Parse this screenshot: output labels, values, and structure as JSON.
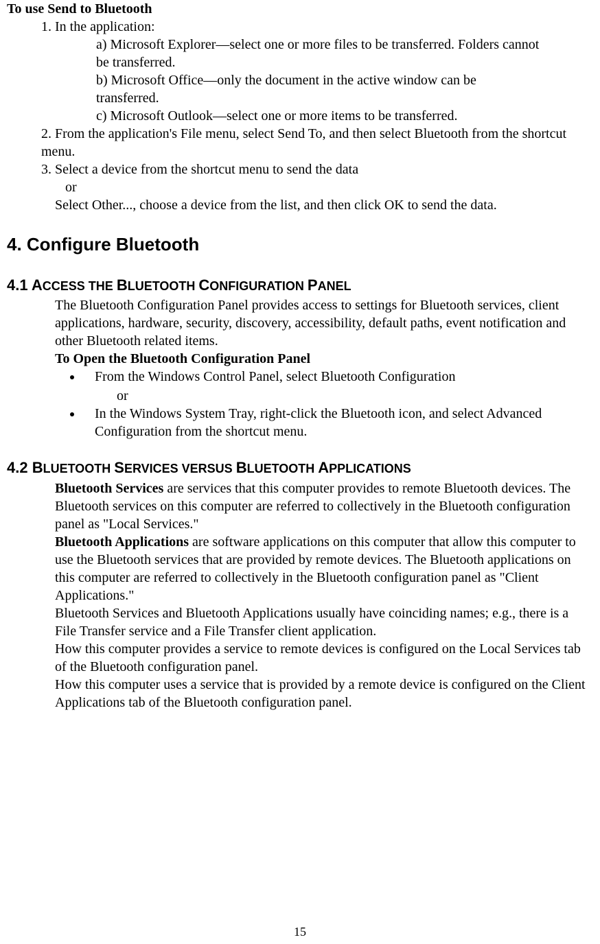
{
  "section_a": {
    "title": "To use Send to Bluetooth",
    "step1_intro": "1. In the application:",
    "step1_a": "a) Microsoft Explorer—select one or more files to be transferred. Folders cannot be transferred.",
    "step1_b": "b) Microsoft Office—only the document in the active window can be transferred.",
    "step1_c": "c) Microsoft Outlook—select one or more items to be transferred.",
    "step2": "2. From the application's File menu, select Send To, and then select Bluetooth from the shortcut menu.",
    "step3_a": "3. Select a device from the shortcut menu to send the data",
    "step3_or": "or",
    "step3_b": "Select Other..., choose a device from the list, and then click OK to send the data."
  },
  "heading_configure": "4. Configure Bluetooth",
  "section_41": {
    "heading_num": "4.1 ",
    "heading_A": "A",
    "heading_ccess": "CCESS THE ",
    "heading_B": "B",
    "heading_luetooth": "LUETOOTH ",
    "heading_C": "C",
    "heading_config": "ONFIGURATION ",
    "heading_P": "P",
    "heading_anel": "ANEL",
    "para": "The Bluetooth Configuration Panel provides access to settings for Bluetooth services, client applications, hardware, security, discovery, accessibility, default paths, event notification and other Bluetooth related items.",
    "toopen": "To Open the Bluetooth Configuration Panel",
    "bullet1": "From the Windows Control Panel, select Bluetooth Configuration",
    "bullet_or": "or",
    "bullet2": "In the Windows System Tray, right-click the Bluetooth icon, and select Advanced Configuration from the shortcut menu."
  },
  "section_42": {
    "heading_num": "4.2 ",
    "heading_B1": "B",
    "heading_luetooth1": "LUETOOTH ",
    "heading_S": "S",
    "heading_erv": "ERVICES VERSUS ",
    "heading_B2": "B",
    "heading_luetooth2": "LUETOOTH ",
    "heading_A": "A",
    "heading_pp": "PPLICATIONS",
    "bt_services_label": "Bluetooth Services",
    "bt_services_text": " are services that this computer provides to remote Bluetooth devices. The Bluetooth services on this computer are referred to collectively in the Bluetooth configuration panel as \"Local Services.\"",
    "bt_apps_label": "Bluetooth Applications",
    "bt_apps_text": " are software applications on this computer that allow this computer to use the Bluetooth services that are provided by remote devices. The Bluetooth applications on this computer are referred to collectively in the Bluetooth configuration panel as \"Client Applications.\"",
    "para3": "Bluetooth Services and Bluetooth Applications usually have coinciding names; e.g., there is a File Transfer service and a File Transfer client application.",
    "para4": "How this computer provides a service to remote devices is configured on the Local Services tab of the Bluetooth configuration panel.",
    "para5": "How this computer uses a service that is provided by a remote device is configured on the Client Applications tab of the Bluetooth configuration panel."
  },
  "page_number": "15"
}
